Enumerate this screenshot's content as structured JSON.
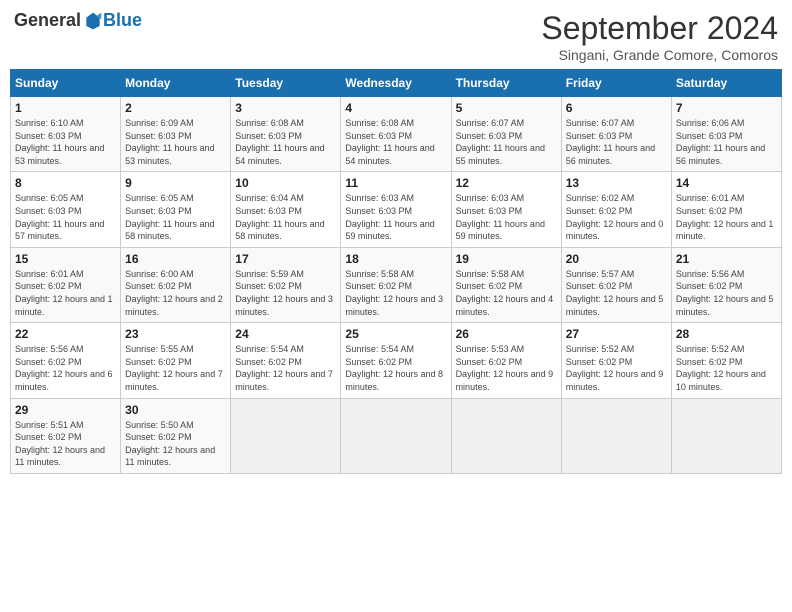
{
  "header": {
    "logo_general": "General",
    "logo_blue": "Blue",
    "month_title": "September 2024",
    "location": "Singani, Grande Comore, Comoros"
  },
  "days_of_week": [
    "Sunday",
    "Monday",
    "Tuesday",
    "Wednesday",
    "Thursday",
    "Friday",
    "Saturday"
  ],
  "weeks": [
    [
      {
        "day": "1",
        "sunrise": "6:10 AM",
        "sunset": "6:03 PM",
        "daylight": "11 hours and 53 minutes."
      },
      {
        "day": "2",
        "sunrise": "6:09 AM",
        "sunset": "6:03 PM",
        "daylight": "11 hours and 53 minutes."
      },
      {
        "day": "3",
        "sunrise": "6:08 AM",
        "sunset": "6:03 PM",
        "daylight": "11 hours and 54 minutes."
      },
      {
        "day": "4",
        "sunrise": "6:08 AM",
        "sunset": "6:03 PM",
        "daylight": "11 hours and 54 minutes."
      },
      {
        "day": "5",
        "sunrise": "6:07 AM",
        "sunset": "6:03 PM",
        "daylight": "11 hours and 55 minutes."
      },
      {
        "day": "6",
        "sunrise": "6:07 AM",
        "sunset": "6:03 PM",
        "daylight": "11 hours and 56 minutes."
      },
      {
        "day": "7",
        "sunrise": "6:06 AM",
        "sunset": "6:03 PM",
        "daylight": "11 hours and 56 minutes."
      }
    ],
    [
      {
        "day": "8",
        "sunrise": "6:05 AM",
        "sunset": "6:03 PM",
        "daylight": "11 hours and 57 minutes."
      },
      {
        "day": "9",
        "sunrise": "6:05 AM",
        "sunset": "6:03 PM",
        "daylight": "11 hours and 58 minutes."
      },
      {
        "day": "10",
        "sunrise": "6:04 AM",
        "sunset": "6:03 PM",
        "daylight": "11 hours and 58 minutes."
      },
      {
        "day": "11",
        "sunrise": "6:03 AM",
        "sunset": "6:03 PM",
        "daylight": "11 hours and 59 minutes."
      },
      {
        "day": "12",
        "sunrise": "6:03 AM",
        "sunset": "6:03 PM",
        "daylight": "11 hours and 59 minutes."
      },
      {
        "day": "13",
        "sunrise": "6:02 AM",
        "sunset": "6:02 PM",
        "daylight": "12 hours and 0 minutes."
      },
      {
        "day": "14",
        "sunrise": "6:01 AM",
        "sunset": "6:02 PM",
        "daylight": "12 hours and 1 minute."
      }
    ],
    [
      {
        "day": "15",
        "sunrise": "6:01 AM",
        "sunset": "6:02 PM",
        "daylight": "12 hours and 1 minute."
      },
      {
        "day": "16",
        "sunrise": "6:00 AM",
        "sunset": "6:02 PM",
        "daylight": "12 hours and 2 minutes."
      },
      {
        "day": "17",
        "sunrise": "5:59 AM",
        "sunset": "6:02 PM",
        "daylight": "12 hours and 3 minutes."
      },
      {
        "day": "18",
        "sunrise": "5:58 AM",
        "sunset": "6:02 PM",
        "daylight": "12 hours and 3 minutes."
      },
      {
        "day": "19",
        "sunrise": "5:58 AM",
        "sunset": "6:02 PM",
        "daylight": "12 hours and 4 minutes."
      },
      {
        "day": "20",
        "sunrise": "5:57 AM",
        "sunset": "6:02 PM",
        "daylight": "12 hours and 5 minutes."
      },
      {
        "day": "21",
        "sunrise": "5:56 AM",
        "sunset": "6:02 PM",
        "daylight": "12 hours and 5 minutes."
      }
    ],
    [
      {
        "day": "22",
        "sunrise": "5:56 AM",
        "sunset": "6:02 PM",
        "daylight": "12 hours and 6 minutes."
      },
      {
        "day": "23",
        "sunrise": "5:55 AM",
        "sunset": "6:02 PM",
        "daylight": "12 hours and 7 minutes."
      },
      {
        "day": "24",
        "sunrise": "5:54 AM",
        "sunset": "6:02 PM",
        "daylight": "12 hours and 7 minutes."
      },
      {
        "day": "25",
        "sunrise": "5:54 AM",
        "sunset": "6:02 PM",
        "daylight": "12 hours and 8 minutes."
      },
      {
        "day": "26",
        "sunrise": "5:53 AM",
        "sunset": "6:02 PM",
        "daylight": "12 hours and 9 minutes."
      },
      {
        "day": "27",
        "sunrise": "5:52 AM",
        "sunset": "6:02 PM",
        "daylight": "12 hours and 9 minutes."
      },
      {
        "day": "28",
        "sunrise": "5:52 AM",
        "sunset": "6:02 PM",
        "daylight": "12 hours and 10 minutes."
      }
    ],
    [
      {
        "day": "29",
        "sunrise": "5:51 AM",
        "sunset": "6:02 PM",
        "daylight": "12 hours and 11 minutes."
      },
      {
        "day": "30",
        "sunrise": "5:50 AM",
        "sunset": "6:02 PM",
        "daylight": "12 hours and 11 minutes."
      },
      null,
      null,
      null,
      null,
      null
    ]
  ]
}
